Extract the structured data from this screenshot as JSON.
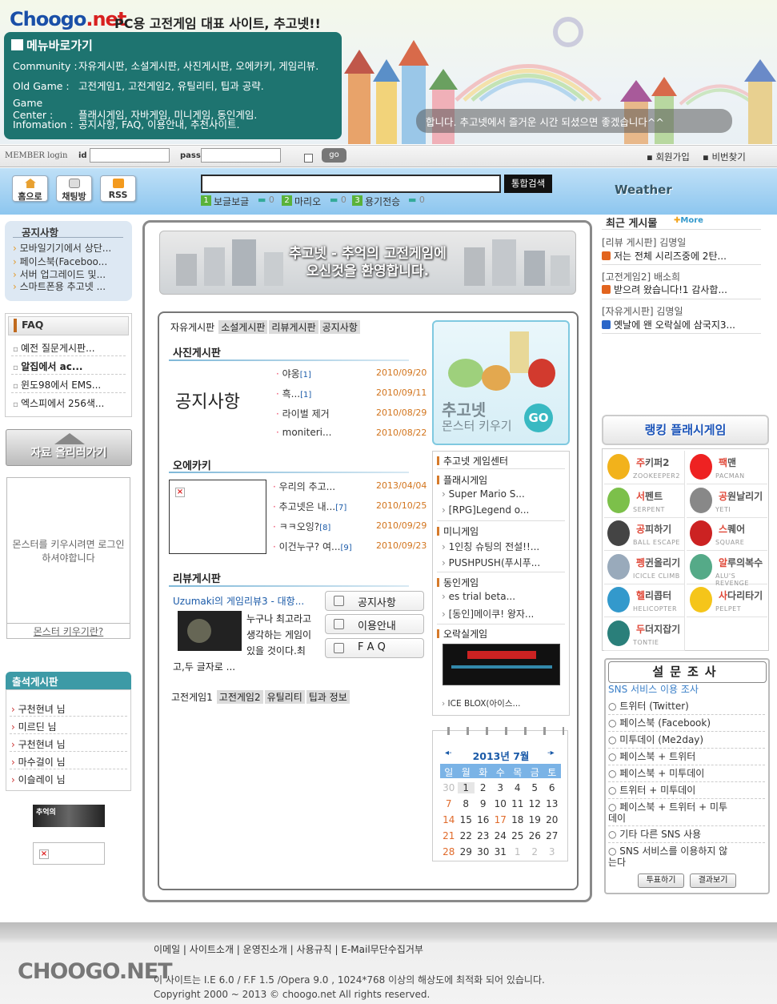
{
  "header": {
    "logo": {
      "part1": "Choogo",
      "part2": ".net"
    },
    "slogan": "PC용 고전게임 대표 사이트, 추고넷!!",
    "menu_title": "메뉴바로가기",
    "menu_rows": [
      {
        "label": "Community :",
        "items": "자유게시판,  소설게시판,  사진게시판,  오에카키,  게임리뷰."
      },
      {
        "label": "Old Game :",
        "items": "고전게임1,   고전게임2,   유틸리티,   팁과 공략."
      },
      {
        "label": "Game Center :",
        "items": "플래시게임,   자바게임,    미니게임,   동인게임."
      },
      {
        "label": "Infomation :",
        "items": "공지사항,  FAQ,  이용안내,  추천사이트."
      }
    ],
    "ticker": "합니다. 추고넷에서 즐거운 시간 되셨으면 좋겠습니다^^"
  },
  "login": {
    "member_login": "MEMBER login",
    "id_label": "id",
    "pass_label": "pass",
    "go": "go",
    "signup": "회원가입",
    "find_pw": "비번찾기"
  },
  "toolbar": {
    "home": "홈으로",
    "chat": "채팅방",
    "rss": "RSS",
    "search_button": "통합검색",
    "weather": "Weather",
    "ranking": [
      {
        "num": "1",
        "label": "보글보글",
        "count": "0"
      },
      {
        "num": "2",
        "label": "마리오",
        "count": "0"
      },
      {
        "num": "3",
        "label": "용기전승",
        "count": "0"
      }
    ]
  },
  "left": {
    "notice_title": "공지사항",
    "notices": [
      "모바일기기에서 상단...",
      "페이스북(Faceboo...",
      "서버 업그레이드 및...",
      "스마트폰용 추고넷 ..."
    ],
    "faq_title": "FAQ",
    "faqs": [
      {
        "text": "예전 질문게시판...",
        "bold": false
      },
      {
        "text": "알집에서 ac...",
        "bold": true
      },
      {
        "text": "윈도98에서 EMS...",
        "bold": false
      },
      {
        "text": "엑스피에서 256색...",
        "bold": false
      }
    ],
    "upload_button": "자료 올리러가기",
    "monster_msg": "몬스터를 키우시려면 로그인 하셔야합니다",
    "monster_link": "몬스터 키우기란?",
    "attend_title": "출석게시판",
    "attend": [
      "구천현녀 님",
      "미르딘 님",
      "구천현녀 님",
      "마수걸이 님",
      "이슬레이 님"
    ],
    "small_banner": "추억의"
  },
  "main": {
    "welcome_line1": "추고넷 - 추억의 고전게임에",
    "welcome_line2": "오신것을 환영합니다.",
    "top_tabs": [
      "자유게시판",
      "소설게시판",
      "리뷰게시판",
      "공지사항"
    ],
    "photo_title": "사진게시판",
    "notice_img_text": "공지사항",
    "photo_posts": [
      {
        "title": "야옹",
        "count": "[1]",
        "date": "2010/09/20"
      },
      {
        "title": "흑...",
        "count": "[1]",
        "date": "2010/09/11"
      },
      {
        "title": "라이벌 제거",
        "count": "",
        "date": "2010/08/29"
      },
      {
        "title": "moniteri...",
        "count": "",
        "date": "2010/08/22"
      }
    ],
    "oekaki_title": "오에카키",
    "oekaki_posts": [
      {
        "title": "우리의 추고...",
        "count": "",
        "date": "2013/04/04"
      },
      {
        "title": "추고넷은 내...",
        "count": "[7]",
        "date": "2010/10/25"
      },
      {
        "title": "ㅋㅋ오잉?",
        "count": "[8]",
        "date": "2010/09/29"
      },
      {
        "title": "이건누구? 여...",
        "count": "[9]",
        "date": "2010/09/23"
      }
    ],
    "review_title": "리뷰게시판",
    "review_post_title": "Uzumaki의 게임리뷰3 - 대항...",
    "review_text": "누구나 최고라고 생각하는 게임이 있을 것이다.최고,두 글자로 ...",
    "quick_buttons": [
      "공지사항",
      "이용안내",
      "F A Q"
    ],
    "bottom_tabs": [
      "고전게임1",
      "고전게임2",
      "유틸리티",
      "팁과 정보"
    ]
  },
  "monster_card": {
    "title": "추고넷",
    "subtitle": "몬스터 키우기",
    "go": "GO"
  },
  "game_center": {
    "title": "추고넷 게임센터",
    "categories": [
      {
        "name": "플래시게임",
        "items": [
          "Super Mario S...",
          "[RPG]Legend o..."
        ]
      },
      {
        "name": "미니게임",
        "items": [
          "1인칭 슈팅의 전설!!...",
          "PUSHPUSH(푸시푸..."
        ]
      },
      {
        "name": "동인게임",
        "items": [
          "es trial beta...",
          "[동인]메이쿠! 왕자..."
        ]
      },
      {
        "name": "오락실게임",
        "items": []
      }
    ],
    "arcade_caption": "ICE BLOX(아이스..."
  },
  "calendar": {
    "title": "2013년 7월",
    "weekdays": [
      "일",
      "월",
      "화",
      "수",
      "목",
      "금",
      "토"
    ],
    "weeks": [
      [
        "30",
        "1",
        "2",
        "3",
        "4",
        "5",
        "6"
      ],
      [
        "7",
        "8",
        "9",
        "10",
        "11",
        "12",
        "13"
      ],
      [
        "14",
        "15",
        "16",
        "17",
        "18",
        "19",
        "20"
      ],
      [
        "21",
        "22",
        "23",
        "24",
        "25",
        "26",
        "27"
      ],
      [
        "28",
        "29",
        "30",
        "31",
        "1",
        "2",
        "3"
      ]
    ]
  },
  "right": {
    "recent_title": "최근 게시물",
    "more": "More",
    "recent": [
      {
        "cat": "[리뷰 게시판] 김명일",
        "body": "저는 전체 시리즈중에 2탄...",
        "color": "#e2641e"
      },
      {
        "cat": "[고전게임2] 배소희",
        "body": "받으려 왔습니다!1 감사합...",
        "color": "#e2641e"
      },
      {
        "cat": "[자유게시판] 김명일",
        "body": "옛날에 왠 오락실에 삼국지3...",
        "color": "#2a66c8"
      }
    ],
    "ranking_title": "랭킹 플래시게임",
    "flash_games": [
      {
        "name": "주키퍼2",
        "hi": "주",
        "sub": "ZOOKEEPER2",
        "color": "#f2b21b"
      },
      {
        "name": "팩맨",
        "hi": "팩",
        "sub": "PACMAN",
        "color": "#e22"
      },
      {
        "name": "서펜트",
        "hi": "서",
        "sub": "SERPENT",
        "color": "#7cc04a"
      },
      {
        "name": "공원날리기",
        "hi": "공",
        "sub": "YETI",
        "color": "#888"
      },
      {
        "name": "공피하기",
        "hi": "공",
        "sub": "BALL ESCAPE",
        "color": "#444"
      },
      {
        "name": "스퀘어",
        "hi": "스",
        "sub": "SQUARE",
        "color": "#c22"
      },
      {
        "name": "펭귄올리기",
        "hi": "펭",
        "sub": "ICICLE CLIMB",
        "color": "#9ab"
      },
      {
        "name": "알루의복수",
        "hi": "알",
        "sub": "ALU'S REVENGE",
        "color": "#5a8"
      },
      {
        "name": "헬리콥터",
        "hi": "헬",
        "sub": "HELICOPTER",
        "color": "#39c"
      },
      {
        "name": "사다리타기",
        "hi": "사",
        "sub": "PELPET",
        "color": "#f5c51a"
      },
      {
        "name": "두더지잡기",
        "hi": "두",
        "sub": "TONTIE",
        "color": "#2a7f7a"
      }
    ],
    "survey_title": "설문조사",
    "survey_question": "SNS 서비스 이용 조사",
    "survey_options": [
      "트위터 (Twitter)",
      "페이스북 (Facebook)",
      "미투데이 (Me2day)",
      "페이스북 + 트위터",
      "페이스북 + 미투데이",
      "트위터 + 미투데이",
      "페이스북 + 트위터 + 미투데이",
      "기타 다른 SNS 사용",
      "SNS 서비스를 이용하지 않는다"
    ],
    "vote": "투표하기",
    "result": "결과보기"
  },
  "footer": {
    "links": "이메일  |  사이트소개  |  운영진소개  |  사용규칙  |  E-Mail무단수집거부",
    "logo": "CHOOGO.NET",
    "note": "이 사이트는 I.E 6.0 / F.F 1.5 /Opera 9.0 ,  1024*768 이상의 해상도에 최적화 되어 있습니다.",
    "copyright": "Copyright 2000 ~ 2013 © choogo.net All rights reserved."
  }
}
